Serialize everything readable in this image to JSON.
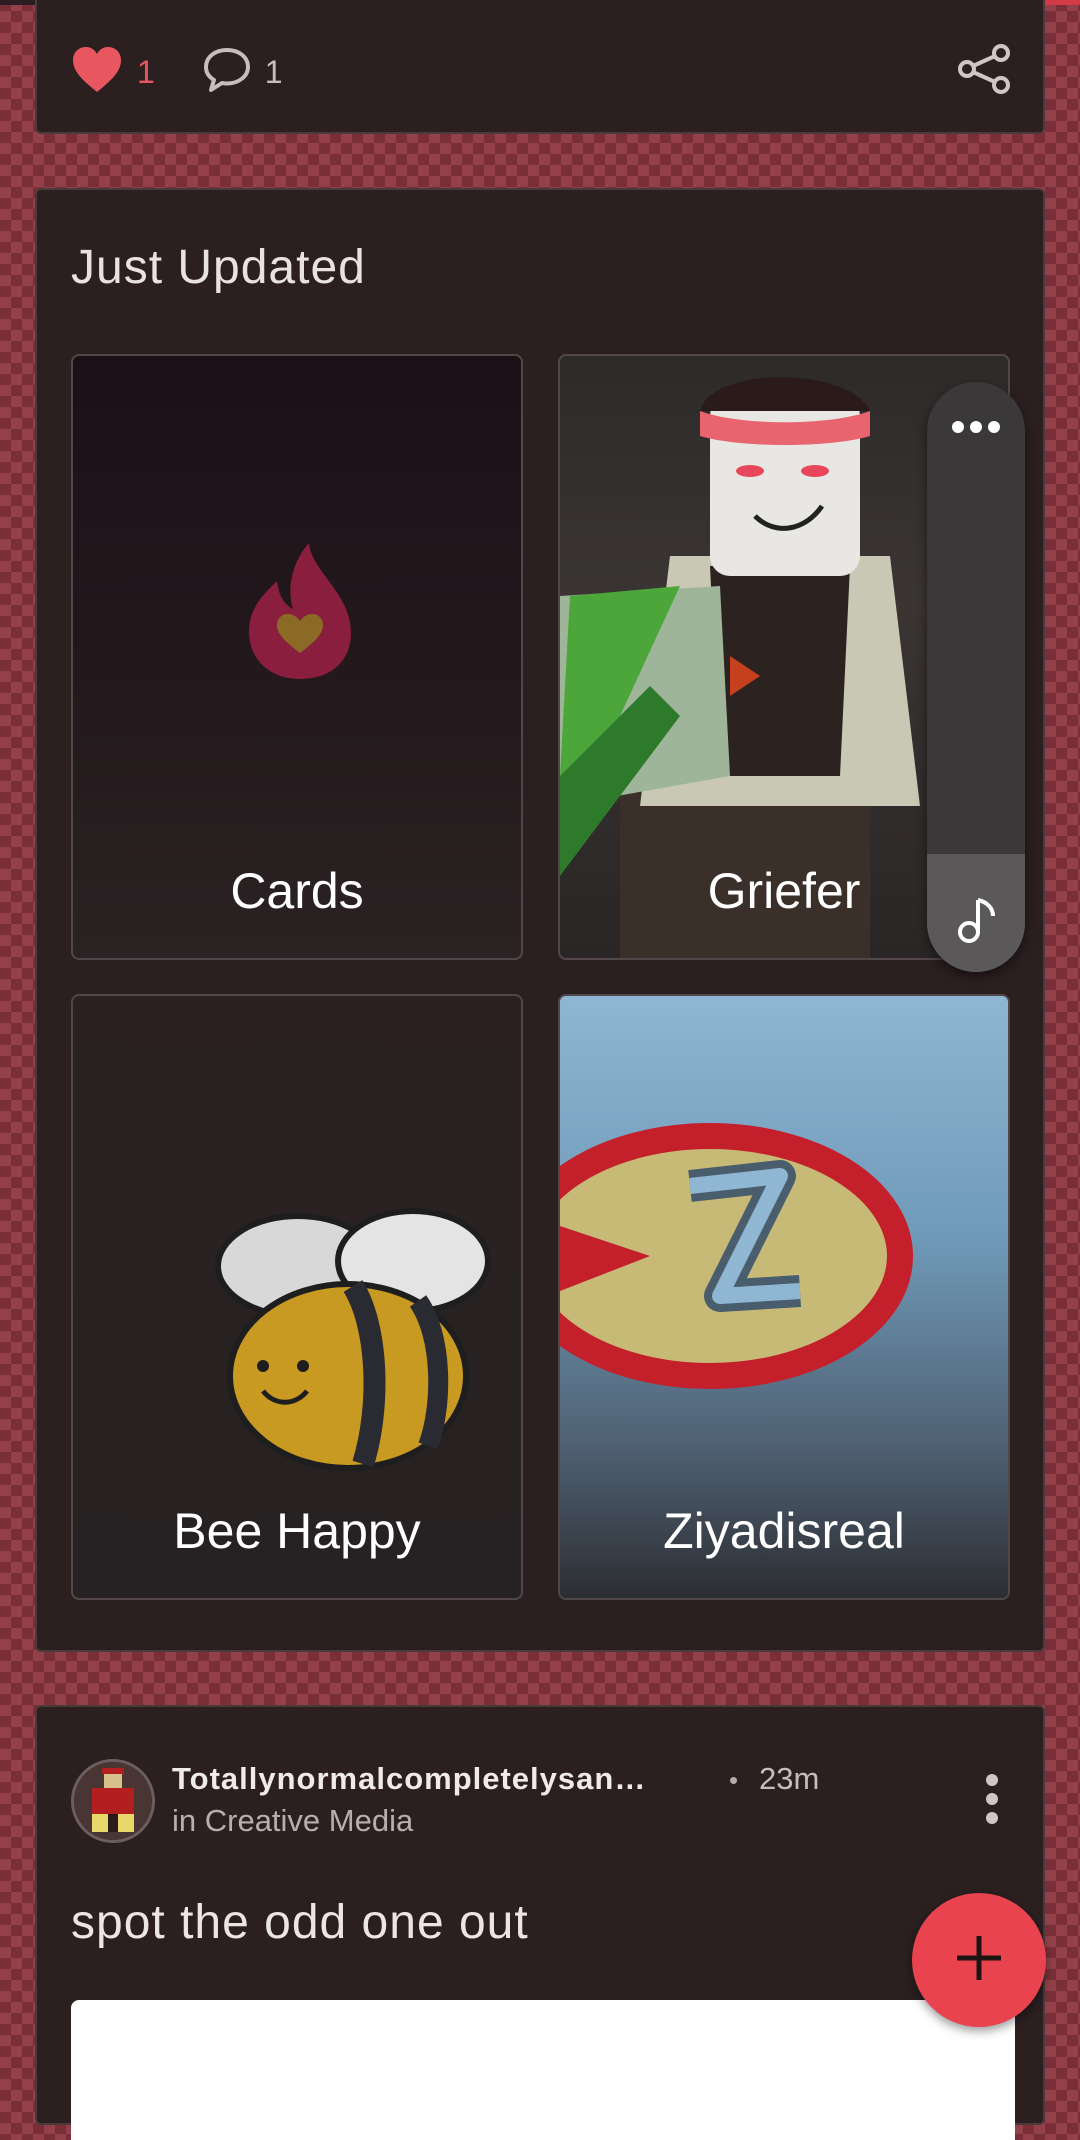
{
  "colors": {
    "accent": "#e8434f",
    "like": "#e8565f",
    "card_bg": "#2b1f20"
  },
  "top_card": {
    "like_count": "1",
    "comment_count": "1",
    "icons": [
      "heart-icon",
      "comment-icon",
      "share-icon"
    ]
  },
  "just_updated": {
    "title": "Just Updated",
    "tiles": [
      {
        "label": "Cards"
      },
      {
        "label": "Griefer"
      },
      {
        "label": "Bee Happy"
      },
      {
        "label": "Ziyadisreal"
      }
    ]
  },
  "music_panel": {
    "icons": [
      "more-horizontal-icon",
      "music-note-icon"
    ]
  },
  "post": {
    "author": "Totallynormalcompletelysan…",
    "separator": "•",
    "time": "23m",
    "community": "in Creative Media",
    "title": "spot the odd one out"
  },
  "fab": {
    "icon": "plus-icon"
  }
}
